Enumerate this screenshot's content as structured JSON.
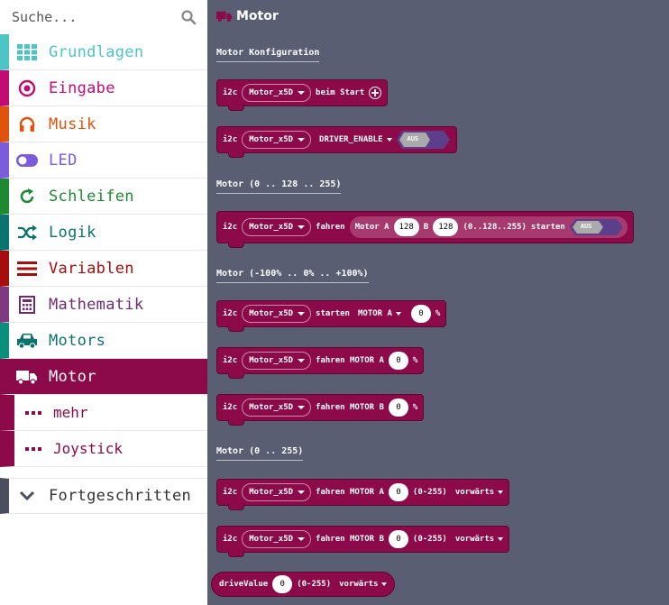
{
  "search": {
    "placeholder": "Suche..."
  },
  "categories": [
    {
      "label": "Grundlagen",
      "color": "#1e90ff",
      "icon": "grid-icon"
    },
    {
      "label": "Eingabe",
      "color": "#d400d4",
      "icon": "target-icon"
    },
    {
      "label": "Musik",
      "color": "#e63022",
      "icon": "headphones-icon"
    },
    {
      "label": "LED",
      "color": "#5c2d91",
      "icon": "toggle-icon"
    },
    {
      "label": "Schleifen",
      "color": "#00aa00",
      "icon": "refresh-icon"
    },
    {
      "label": "Logik",
      "color": "#00a4a6",
      "icon": "shuffle-icon"
    },
    {
      "label": "Variablen",
      "color": "#dc143c",
      "icon": "lines-icon"
    },
    {
      "label": "Mathematik",
      "color": "#9400d3",
      "icon": "calculator-icon"
    },
    {
      "label": "Motors",
      "color": "#008272",
      "icon": "car-icon"
    },
    {
      "label": "Motor",
      "color": "#8d0a4a",
      "icon": "truck-icon"
    }
  ],
  "subcategories": [
    {
      "label": "mehr"
    },
    {
      "label": "Joystick"
    }
  ],
  "advanced": {
    "label": "Fortgeschritten"
  },
  "workspace": {
    "title": "Motor",
    "sections": {
      "konfig": "Motor Konfiguration",
      "range128": "Motor (0 .. 128 .. 255)",
      "percent": "Motor (-100% .. 0% .. +100%)",
      "range255": "Motor (0 .. 255)"
    },
    "blocks": {
      "i2c": "i2c",
      "device": "Motor_x5D",
      "beim_start": "beim Start",
      "driver_enable": "DRIVER_ENABLE",
      "aus": "AUS",
      "fahren": "fahren",
      "motor_a_lbl": "Motor A",
      "b_lbl": "B",
      "val_a": "128",
      "val_b": "128",
      "range_lbl": "(0..128..255)",
      "starten": "starten",
      "starten2": "starten",
      "motor_a_dd": "MOTOR A",
      "zero": "0",
      "percent": "%",
      "fahren_motor_a": "fahren MOTOR A",
      "fahren_motor_b": "fahren MOTOR B",
      "range255": "(0-255)",
      "vorwaerts": "vorwärts",
      "drive_value": "driveValue"
    }
  },
  "colors": {
    "sidebar_stripes": [
      "#4dc5c7",
      "#c30b74",
      "#e0530d",
      "#7a5cdc",
      "#1d8a32",
      "#0a7370",
      "#a80d0d",
      "#7d3a80",
      "#0a8f7a",
      "#8d0a4a"
    ],
    "label_colors": [
      "#4dc5c7",
      "#c30b74",
      "#e0530d",
      "#7a5cdc",
      "#1d8a32",
      "#0a7370",
      "#a80d0d",
      "#6e2b6e",
      "#0a7370",
      "#ffffff"
    ],
    "block": "#8d0a4a",
    "workspace_bg": "#595e73"
  }
}
